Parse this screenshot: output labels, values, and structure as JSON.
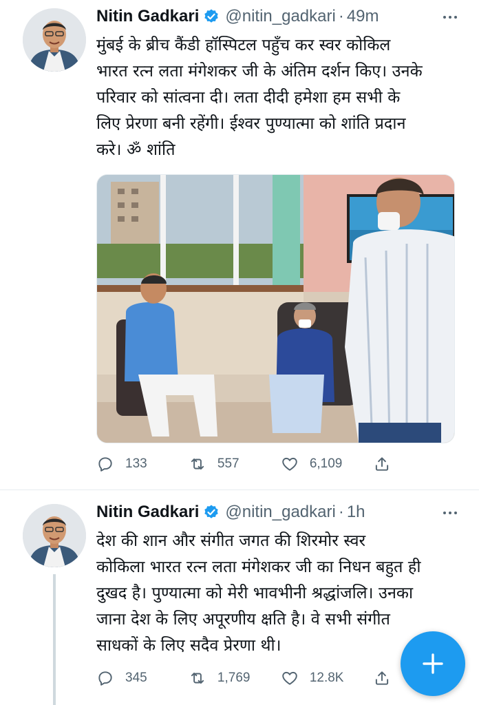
{
  "tweets": [
    {
      "author": {
        "name": "Nitin Gadkari",
        "handle": "@nitin_gadkari",
        "verified": true
      },
      "time": "49m",
      "separator": "·",
      "text": "मुंबई के ब्रीच कैंडी हॉस्पिटल पहुँच कर स्वर कोकिल\nभारत रत्न लता मंगेशकर जी के अंतिम दर्शन किए। उनके\nपरिवार को सांत्वना दी। लता दीदी हमेशा हम सभी के\nलिए प्रेरणा बनी रहेंगी। ईश्वर पुण्यात्मा को शांति प्रदान\nकरे। ॐ शांति",
      "stats": {
        "replies": "133",
        "retweets": "557",
        "likes": "6,109"
      }
    },
    {
      "author": {
        "name": "Nitin Gadkari",
        "handle": "@nitin_gadkari",
        "verified": true
      },
      "time": "1h",
      "separator": "·",
      "text": "देश की शान और संगीत जगत की शिरमोर स्वर\nकोकिला भारत रत्न लता मंगेशकर जी का निधन बहुत ही\nदुखद है। पुण्यात्मा को मेरी भावभीनी श्रद्धांजलि। उनका\nजाना देश के लिए अपूरणीय क्षति है। वे सभी संगीत\nसाधकों के लिए सदैव प्रेरणा थी।",
      "stats": {
        "replies": "345",
        "retweets": "1,769",
        "likes": "12.8K"
      }
    }
  ],
  "icons": {
    "verified": "verified-badge-icon",
    "more": "more-dots-icon",
    "reply": "reply-icon",
    "retweet": "retweet-icon",
    "like": "heart-icon",
    "share": "share-icon",
    "compose": "plus-icon"
  },
  "colors": {
    "accent": "#1d9bf0",
    "secondary_text": "#536471",
    "primary_text": "#0f1419"
  }
}
